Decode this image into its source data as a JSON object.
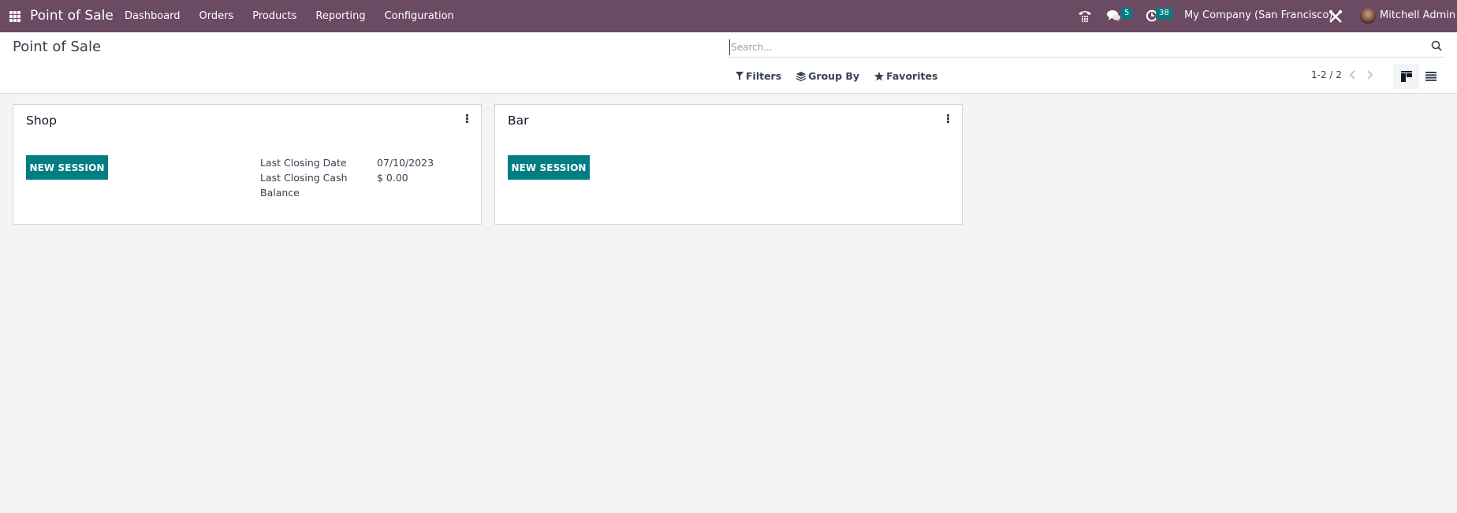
{
  "navbar": {
    "apps_icon": "apps-grid-icon",
    "brand": "Point of Sale",
    "menu": [
      "Dashboard",
      "Orders",
      "Products",
      "Reporting",
      "Configuration"
    ],
    "systray": {
      "phone_icon": "phone-icon",
      "messages_icon": "chat-icon",
      "messages_count": "5",
      "activities_icon": "clock-icon",
      "activities_count": "38",
      "company": "My Company (San Francisco)",
      "debug_icon": "tools-icon",
      "user": "Mitchell Admin"
    },
    "colors": {
      "background": "#6b4a63",
      "badge": "#017e84"
    }
  },
  "control_panel": {
    "title": "Point of Sale",
    "search": {
      "placeholder": "Search...",
      "value": ""
    },
    "filters": [
      {
        "label": "Filters",
        "icon": "filter-icon"
      },
      {
        "label": "Group By",
        "icon": "layers-icon"
      },
      {
        "label": "Favorites",
        "icon": "star-icon"
      }
    ],
    "pager": {
      "value": "1-2 / 2"
    },
    "views": [
      {
        "name": "kanban",
        "icon": "kanban-view-icon",
        "active": true
      },
      {
        "name": "list",
        "icon": "list-view-icon",
        "active": false
      }
    ]
  },
  "kanban": {
    "cards": [
      {
        "title": "Shop",
        "button": "NEW SESSION",
        "info": [
          {
            "label": "Last Closing Date",
            "value": "07/10/2023"
          },
          {
            "label": "Last Closing Cash Balance",
            "label_line1": "Last Closing Cash",
            "label_line2": "Balance",
            "value": "$ 0.00"
          }
        ]
      },
      {
        "title": "Bar",
        "button": "NEW SESSION",
        "info": []
      }
    ],
    "colors": {
      "primary": "#017e84"
    }
  }
}
